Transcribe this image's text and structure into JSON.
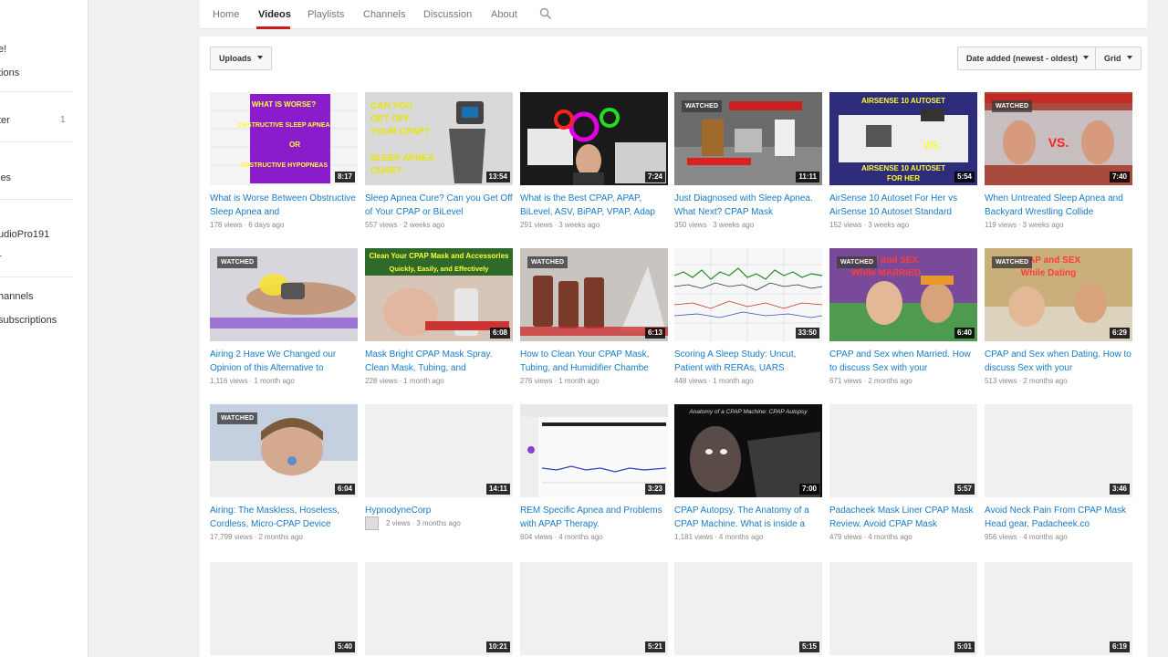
{
  "sidebar": {
    "items": [
      {
        "label": "e!"
      },
      {
        "label": "tions"
      },
      {
        "label": "ter",
        "count": "1"
      },
      {
        "label": "ies"
      },
      {
        "label": "udioPro191"
      },
      {
        "label": "r"
      },
      {
        "label": "hannels"
      },
      {
        "label": "subscriptions"
      }
    ]
  },
  "nav": {
    "tabs": [
      "Home",
      "Videos",
      "Playlists",
      "Channels",
      "Discussion",
      "About"
    ],
    "active": "Videos"
  },
  "toolbar": {
    "uploads_label": "Uploads",
    "sort_label": "Date added (newest - oldest)",
    "view_label": "Grid"
  },
  "colors": {
    "accent": "#cc181e",
    "link": "#167ac6"
  },
  "videos": [
    {
      "title": "What is Worse Between Obstructive Sleep Apnea and",
      "views": "178 views",
      "age": "6 days ago",
      "duration": "8:17",
      "watched": false
    },
    {
      "title": "Sleep Apnea Cure? Can you Get Off of Your CPAP or BiLevel",
      "views": "557 views",
      "age": "2 weeks ago",
      "duration": "13:54",
      "watched": false
    },
    {
      "title": "What is the Best CPAP, APAP, BiLevel, ASV, BiPAP, VPAP, Adap",
      "views": "291 views",
      "age": "3 weeks ago",
      "duration": "7:24",
      "watched": false
    },
    {
      "title": "Just Diagnosed with Sleep Apnea. What Next? CPAP Mask",
      "views": "350 views",
      "age": "3 weeks ago",
      "duration": "11:11",
      "watched": true
    },
    {
      "title": "AirSense 10 Autoset For Her vs AirSense 10 Autoset Standard",
      "views": "152 views",
      "age": "3 weeks ago",
      "duration": "5:54",
      "watched": false
    },
    {
      "title": "When Untreated Sleep Apnea and Backyard Wrestling Collide",
      "views": "119 views",
      "age": "3 weeks ago",
      "duration": "7:40",
      "watched": true
    },
    {
      "title": "Airing 2 Have We Changed our Opinion of this Alternative to",
      "views": "1,116 views",
      "age": "1 month ago",
      "duration": "",
      "watched": true
    },
    {
      "title": "Mask Bright CPAP Mask Spray. Clean Mask, Tubing, and",
      "views": "228 views",
      "age": "1 month ago",
      "duration": "6:08",
      "watched": false
    },
    {
      "title": "How to Clean Your CPAP Mask, Tubing, and Humidifier Chambe",
      "views": "276 views",
      "age": "1 month ago",
      "duration": "6:13",
      "watched": true
    },
    {
      "title": "Scoring A Sleep Study: Uncut, Patient with RERAs, UARS",
      "views": "448 views",
      "age": "1 month ago",
      "duration": "33:50",
      "watched": false
    },
    {
      "title": "CPAP and Sex when Married. How to discuss Sex with your",
      "views": "671 views",
      "age": "2 months ago",
      "duration": "6:40",
      "watched": true
    },
    {
      "title": "CPAP and Sex when Dating. How to discuss Sex with your",
      "views": "513 views",
      "age": "2 months ago",
      "duration": "6:29",
      "watched": true
    },
    {
      "title": "Airing: The Maskless, Hoseless, Cordless, Micro-CPAP Device",
      "views": "17,799 views",
      "age": "2 months ago",
      "duration": "6:04",
      "watched": true
    },
    {
      "title": "HypnodyneCorp",
      "views": "2 views",
      "age": "3 months ago",
      "duration": "14:11",
      "watched": false
    },
    {
      "title": "REM Specific Apnea and Problems with APAP Therapy.",
      "views": "604 views",
      "age": "4 months ago",
      "duration": "3:23",
      "watched": false
    },
    {
      "title": "CPAP Autopsy. The Anatomy of a CPAP Machine. What is inside a",
      "views": "1,181 views",
      "age": "4 months ago",
      "duration": "7:00",
      "watched": false
    },
    {
      "title": "Padacheek Mask Liner CPAP Mask Review. Avoid CPAP Mask",
      "views": "479 views",
      "age": "4 months ago",
      "duration": "5:57",
      "watched": false
    },
    {
      "title": "Avoid Neck Pain From CPAP Mask Head gear. Padacheek.co",
      "views": "956 views",
      "age": "4 months ago",
      "duration": "3:46",
      "watched": false
    },
    {
      "title": "",
      "views": "",
      "age": "",
      "duration": "5:40",
      "watched": false
    },
    {
      "title": "",
      "views": "",
      "age": "",
      "duration": "10:21",
      "watched": false
    },
    {
      "title": "",
      "views": "",
      "age": "",
      "duration": "5:21",
      "watched": false
    },
    {
      "title": "",
      "views": "",
      "age": "",
      "duration": "5:15",
      "watched": false
    },
    {
      "title": "",
      "views": "",
      "age": "",
      "duration": "5:01",
      "watched": false
    },
    {
      "title": "",
      "views": "",
      "age": "",
      "duration": "6:19",
      "watched": false
    }
  ],
  "watched_label": "WATCHED",
  "thumb_text": {
    "t0": [
      "WHAT IS WORSE?",
      "OBSTRUCTIVE SLEEP APNEA",
      "OR",
      "OBSTRUCTIVE HYPOPNEAS"
    ],
    "t1": [
      "CAN YOU",
      "GET OFF",
      "YOUR CPAP?",
      "SLEEP APNEA",
      "CURE?"
    ],
    "t4": [
      "AIRSENSE 10 AUTOSET",
      "VS.",
      "AIRSENSE 10 AUTOSET",
      "FOR HER"
    ],
    "t5": [
      "VS."
    ],
    "t7": [
      "Clean Your CPAP Mask and Accessories",
      "Quickly, Easily, and Effectively"
    ],
    "t10": [
      "CPAP and SEX",
      "While MARRIED"
    ],
    "t11": [
      "CPAP and SEX",
      "While Dating"
    ],
    "t15": [
      "Anatomy of a CPAP Machine: CPAP Autopsy"
    ]
  }
}
